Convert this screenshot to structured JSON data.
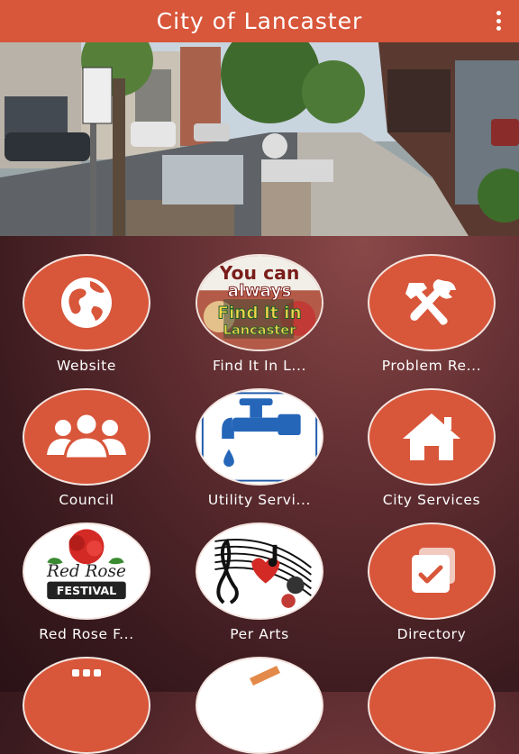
{
  "header": {
    "title": "City of Lancaster"
  },
  "tiles": [
    {
      "label": "Website",
      "icon": "globe-icon"
    },
    {
      "label": "Find It In L...",
      "icon": "find-it-in-lancaster-image",
      "art_line1": "You can",
      "art_line2": "always",
      "art_line3": "Find It in",
      "art_line4": "Lancaster"
    },
    {
      "label": "Problem Re...",
      "icon": "tools-icon"
    },
    {
      "label": "Council",
      "icon": "group-icon"
    },
    {
      "label": "Utility Servi...",
      "icon": "water-faucet-image"
    },
    {
      "label": "City Services",
      "icon": "home-icon"
    },
    {
      "label": "Red Rose F...",
      "icon": "red-rose-festival-image",
      "art_line1": "Red Rose",
      "art_line2": "FESTIVAL"
    },
    {
      "label": "Per Arts",
      "icon": "performing-arts-image"
    },
    {
      "label": "Directory",
      "icon": "directory-icon"
    }
  ],
  "colors": {
    "accent": "#d8563a",
    "background": "#4a2226"
  }
}
